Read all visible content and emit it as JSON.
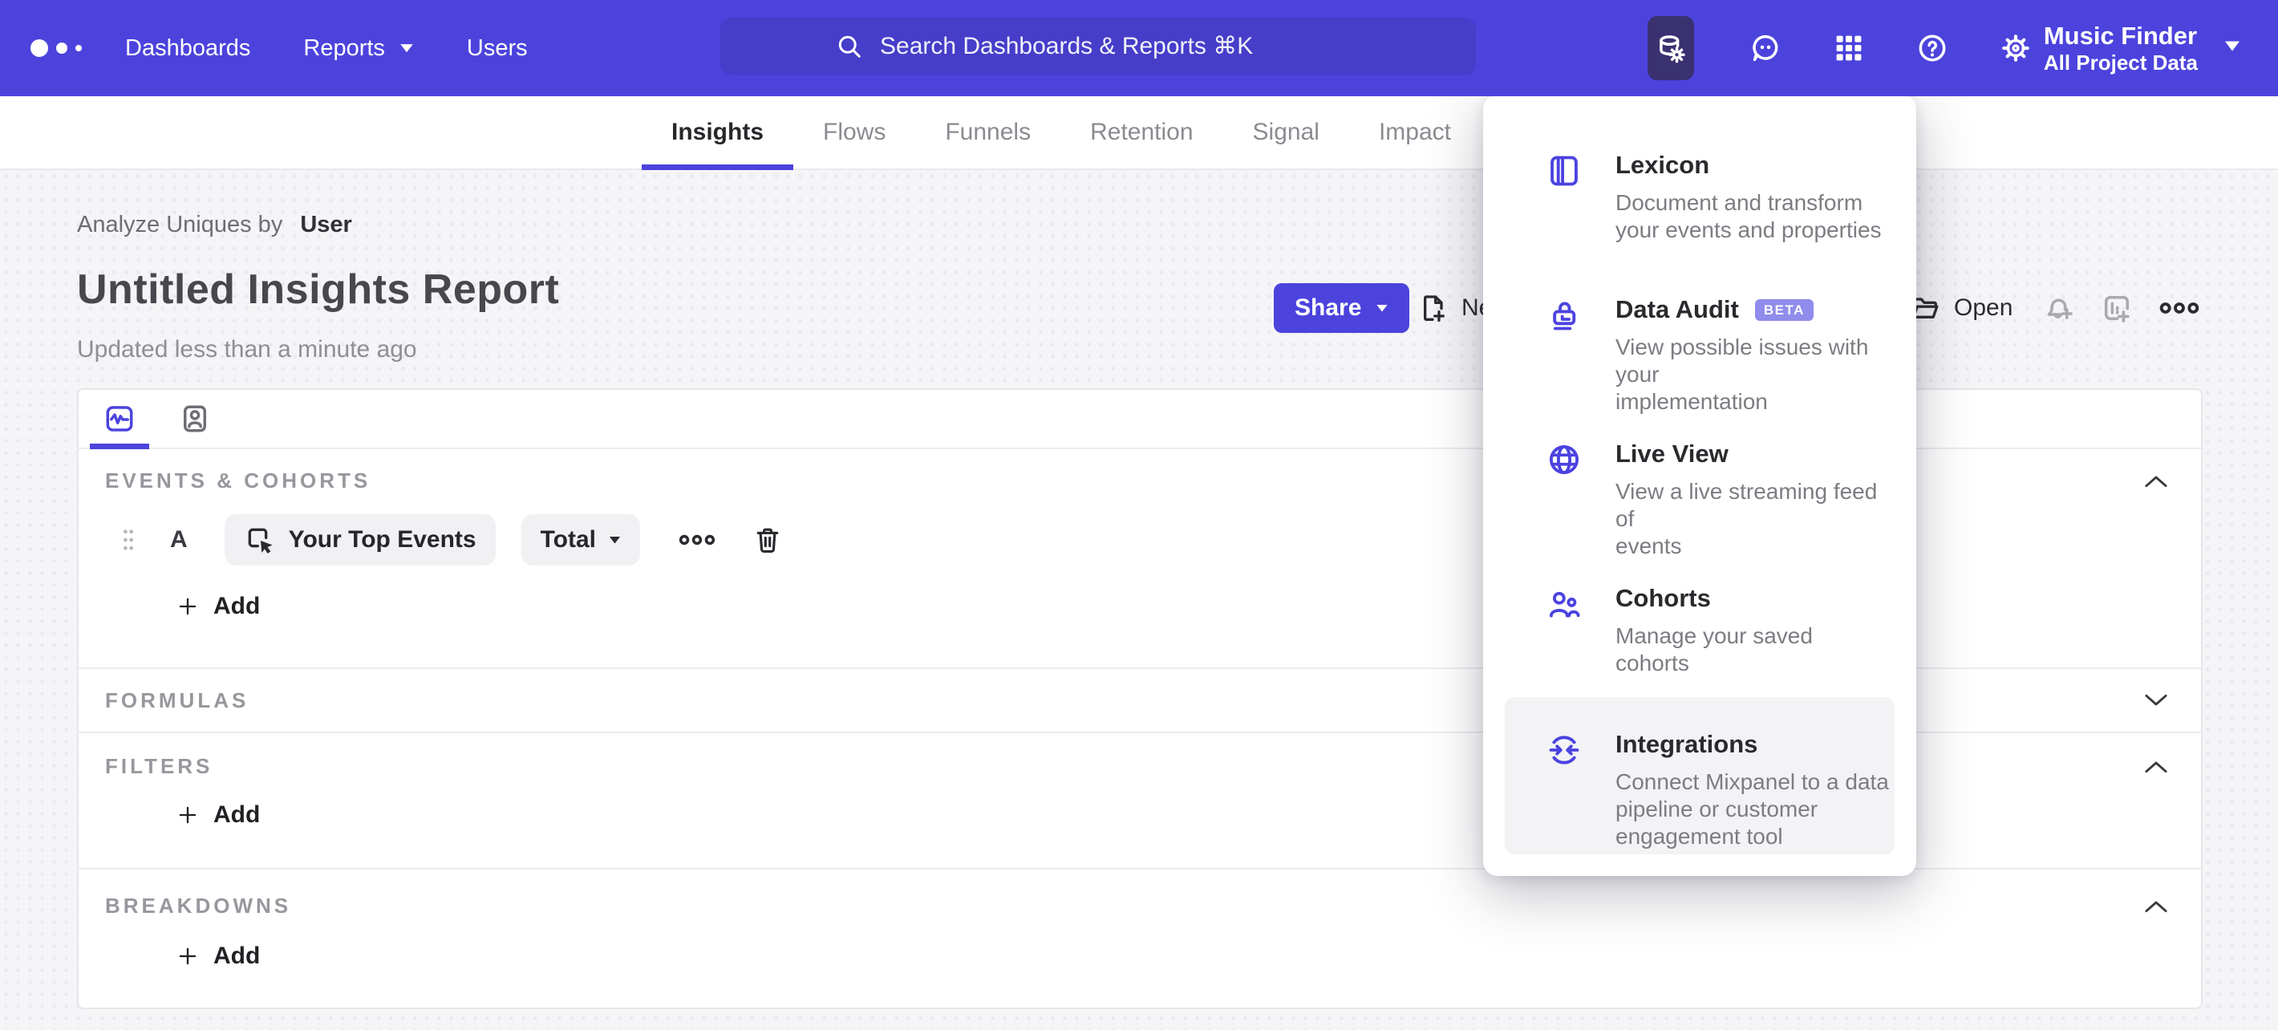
{
  "topnav": {
    "items": [
      {
        "label": "Dashboards"
      },
      {
        "label": "Reports"
      },
      {
        "label": "Users"
      }
    ],
    "search_placeholder": "Search Dashboards & Reports ⌘K",
    "project": {
      "name": "Music Finder",
      "scope": "All Project Data"
    }
  },
  "tabs": [
    {
      "label": "Insights"
    },
    {
      "label": "Flows"
    },
    {
      "label": "Funnels"
    },
    {
      "label": "Retention"
    },
    {
      "label": "Signal"
    },
    {
      "label": "Impact"
    }
  ],
  "report": {
    "analyze_label": "Analyze Uniques by",
    "analyze_value": "User",
    "title": "Untitled Insights Report",
    "updated": "Updated less than a minute ago"
  },
  "toolbar": {
    "share_label": "Share",
    "new_label": "New",
    "open_label": "Open"
  },
  "menu": {
    "items": [
      {
        "title": "Lexicon",
        "lines": [
          "Document and transform",
          "your events and properties"
        ]
      },
      {
        "title": "Data Audit",
        "badge": "BETA",
        "lines": [
          "View possible issues with your",
          "implementation"
        ]
      },
      {
        "title": "Live View",
        "lines": [
          "View a live streaming feed of",
          "events"
        ]
      },
      {
        "title": "Cohorts",
        "lines": [
          "Manage your saved cohorts"
        ]
      },
      {
        "title": "Integrations",
        "lines": [
          "Connect Mixpanel to a data",
          "pipeline or customer",
          "engagement tool"
        ]
      }
    ]
  },
  "builder": {
    "events_label": "EVENTS & COHORTS",
    "series_letter": "A",
    "event_name": "Your Top Events",
    "metric": "Total",
    "add_label": "Add",
    "formulas_label": "FORMULAS",
    "filters_label": "FILTERS",
    "breakdowns_label": "BREAKDOWNS"
  },
  "colors": {
    "nav_bg": "#4c43dd",
    "search_bg": "#463dc9",
    "active_tool_bg": "#3a3171",
    "accent": "#4c43dd",
    "beta_badge_bg": "#8f8cec",
    "page_bg": "#f5f5f7",
    "card_bg": "#ffffff"
  },
  "icons": [
    "mixpanel-logo-dots",
    "caret-down-icon",
    "search-icon",
    "data-settings-icon",
    "feedback-icon",
    "apps-grid-icon",
    "help-icon",
    "settings-gear-icon",
    "new-report-icon",
    "open-folder-icon",
    "subscribe-bell-icon",
    "add-to-board-icon",
    "more-icon",
    "metrics-tab-icon",
    "profiles-tab-icon",
    "drag-handle-icon",
    "event-click-icon",
    "trash-icon",
    "plus-icon",
    "chevron-up-icon",
    "chevron-down-icon",
    "lexicon-icon",
    "data-audit-icon",
    "live-view-icon",
    "cohorts-icon",
    "integrations-icon"
  ]
}
